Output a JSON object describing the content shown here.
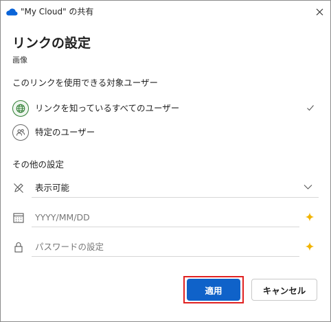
{
  "window": {
    "title": "\"My Cloud\" の共有"
  },
  "heading": "リンクの設定",
  "subheading": "画像",
  "audience": {
    "label": "このリンクを使用できる対象ユーザー",
    "options": [
      {
        "label": "リンクを知っているすべてのユーザー",
        "icon": "globe-icon",
        "selected": true
      },
      {
        "label": "特定のユーザー",
        "icon": "people-icon",
        "selected": false
      }
    ]
  },
  "other": {
    "label": "その他の設定",
    "permission": {
      "value": "表示可能",
      "icon": "pencil-off-icon"
    },
    "expiry": {
      "placeholder": "YYYY/MM/DD",
      "icon": "calendar-icon",
      "premium_icon": "sparkle-icon"
    },
    "password": {
      "placeholder": "パスワードの設定",
      "icon": "lock-icon",
      "premium_icon": "sparkle-icon"
    }
  },
  "buttons": {
    "apply": "適用",
    "cancel": "キャンセル"
  },
  "colors": {
    "accent": "#0f62c9",
    "highlight": "#e02020",
    "premium": "#f2b400",
    "onedrive": "#0a64d8",
    "selected_icon": "#2e7d32"
  }
}
